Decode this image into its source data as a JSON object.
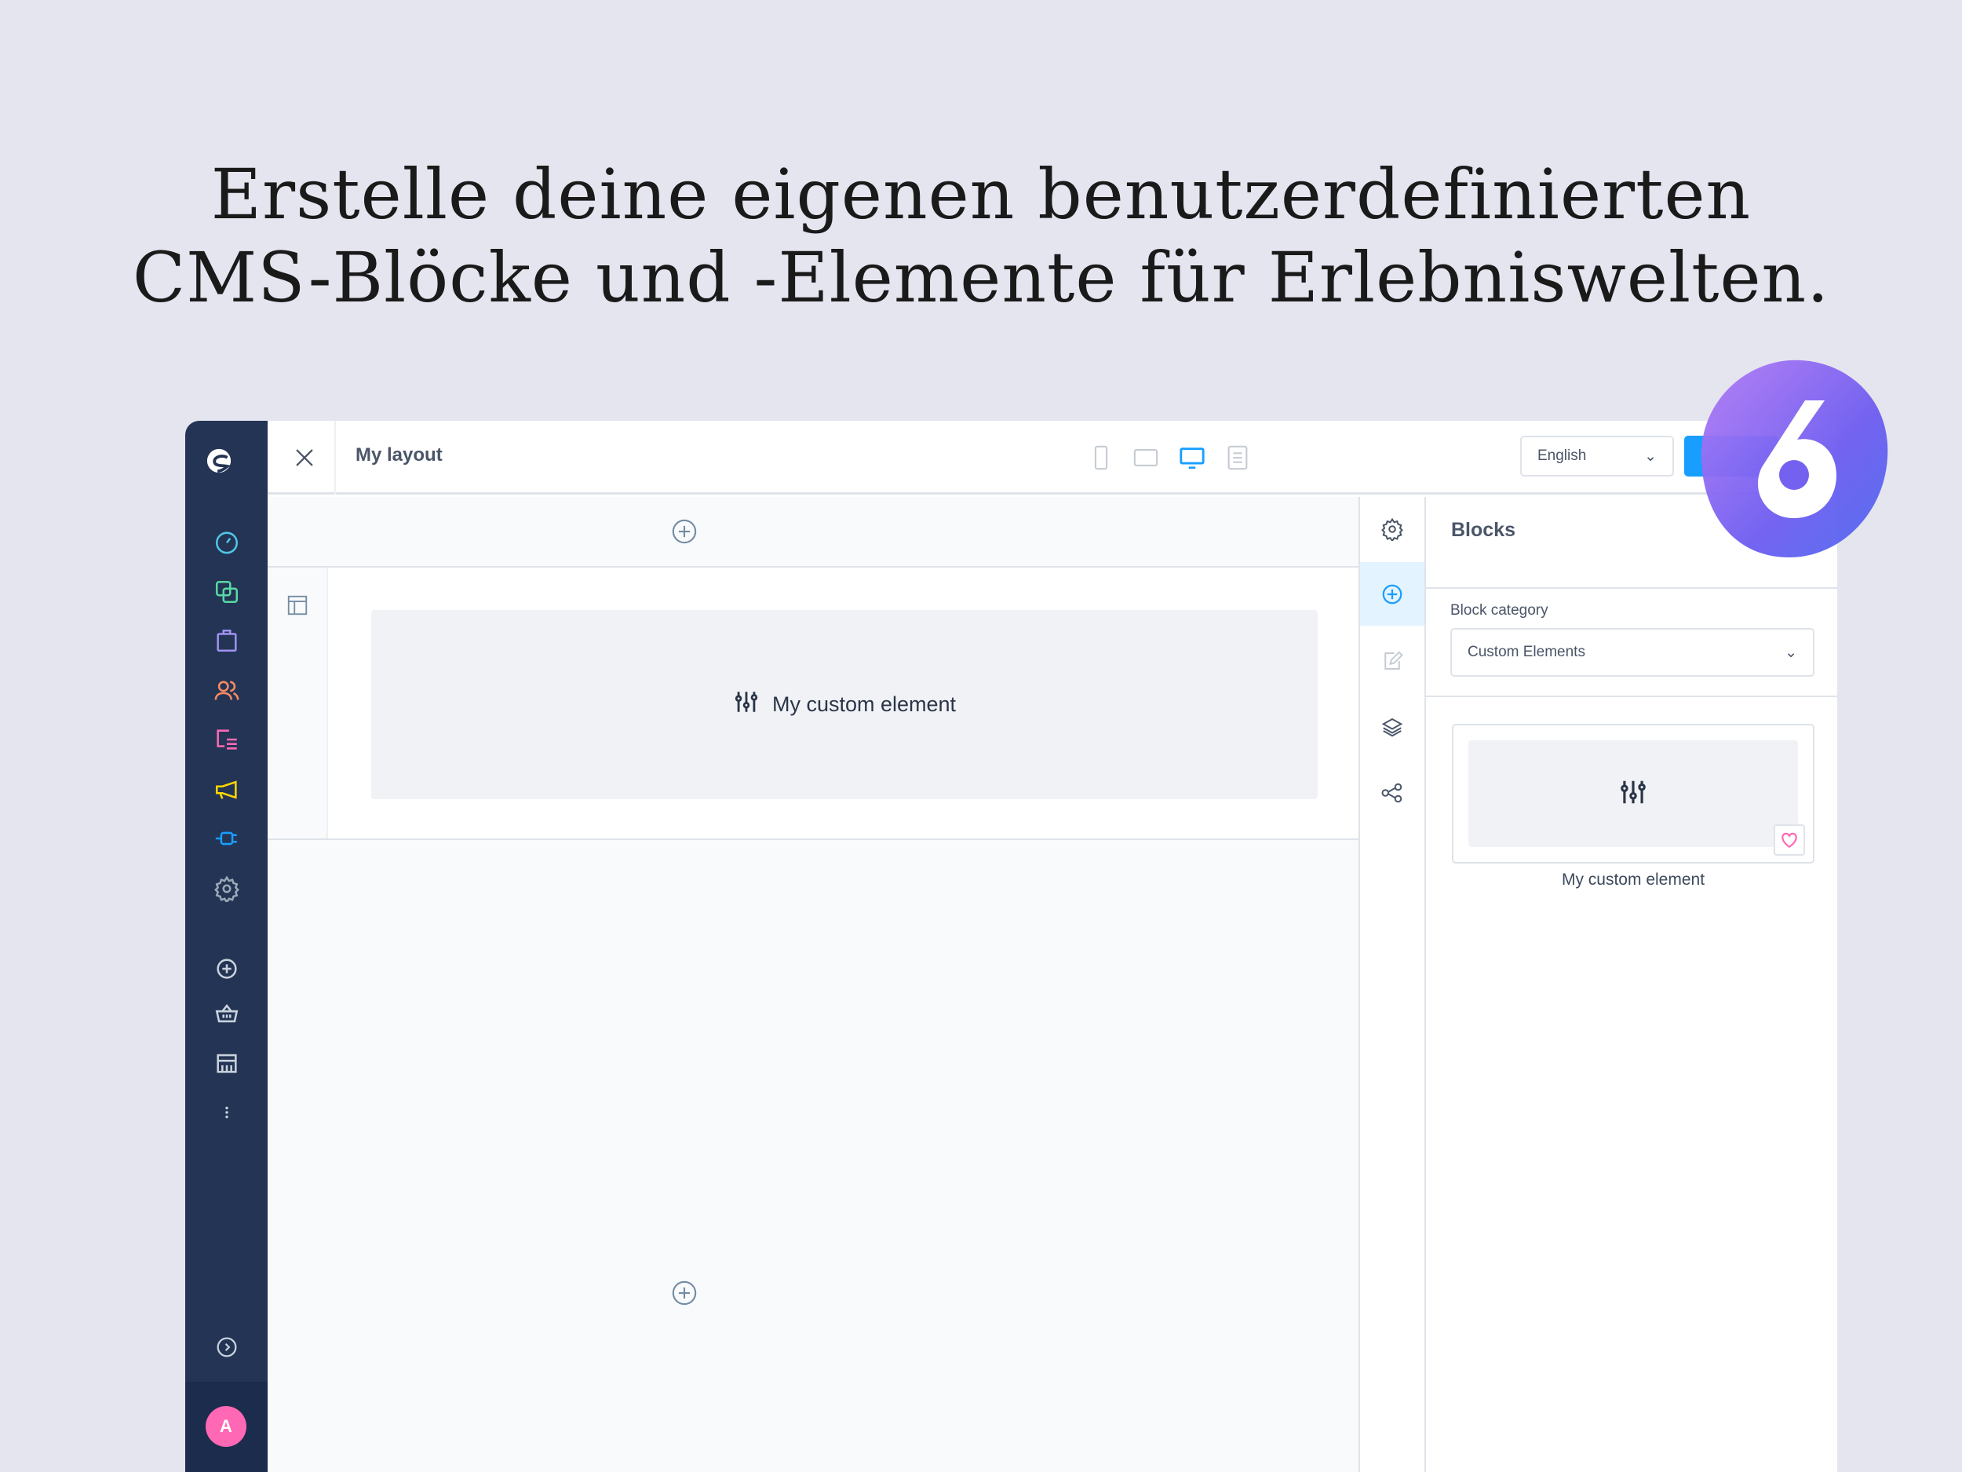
{
  "headline": {
    "line1": "Erstelle deine eigenen benutzerdefinierten",
    "line2": "CMS-Blöcke und -Elemente für Erlebniswelten."
  },
  "sidebar": {
    "items": [
      {
        "icon": "dashboard-icon",
        "color": "#50c5e5"
      },
      {
        "icon": "catalog-icon",
        "color": "#57d9a3"
      },
      {
        "icon": "orders-icon",
        "color": "#a092f0"
      },
      {
        "icon": "customers-icon",
        "color": "#f88962"
      },
      {
        "icon": "content-icon",
        "color": "#ff68b4"
      },
      {
        "icon": "marketing-icon",
        "color": "#ffd700"
      },
      {
        "icon": "extensions-icon",
        "color": "#189eff"
      },
      {
        "icon": "settings-icon",
        "color": "#9aa8b5"
      }
    ],
    "secondary": [
      "add-circle-icon",
      "basket-icon",
      "storefront-icon",
      "more-icon"
    ],
    "avatar": "A",
    "avatar_color": "#ff68b4"
  },
  "topbar": {
    "title": "My layout",
    "language": "English",
    "devices": [
      "mobile",
      "tablet",
      "desktop",
      "list"
    ],
    "active_device": "desktop",
    "accent": "#189eff"
  },
  "canvas": {
    "element_label": "My custom element"
  },
  "panel": {
    "title": "Blocks",
    "category_label": "Block category",
    "category_value": "Custom Elements",
    "block_label": "My custom element"
  },
  "badge": "6"
}
